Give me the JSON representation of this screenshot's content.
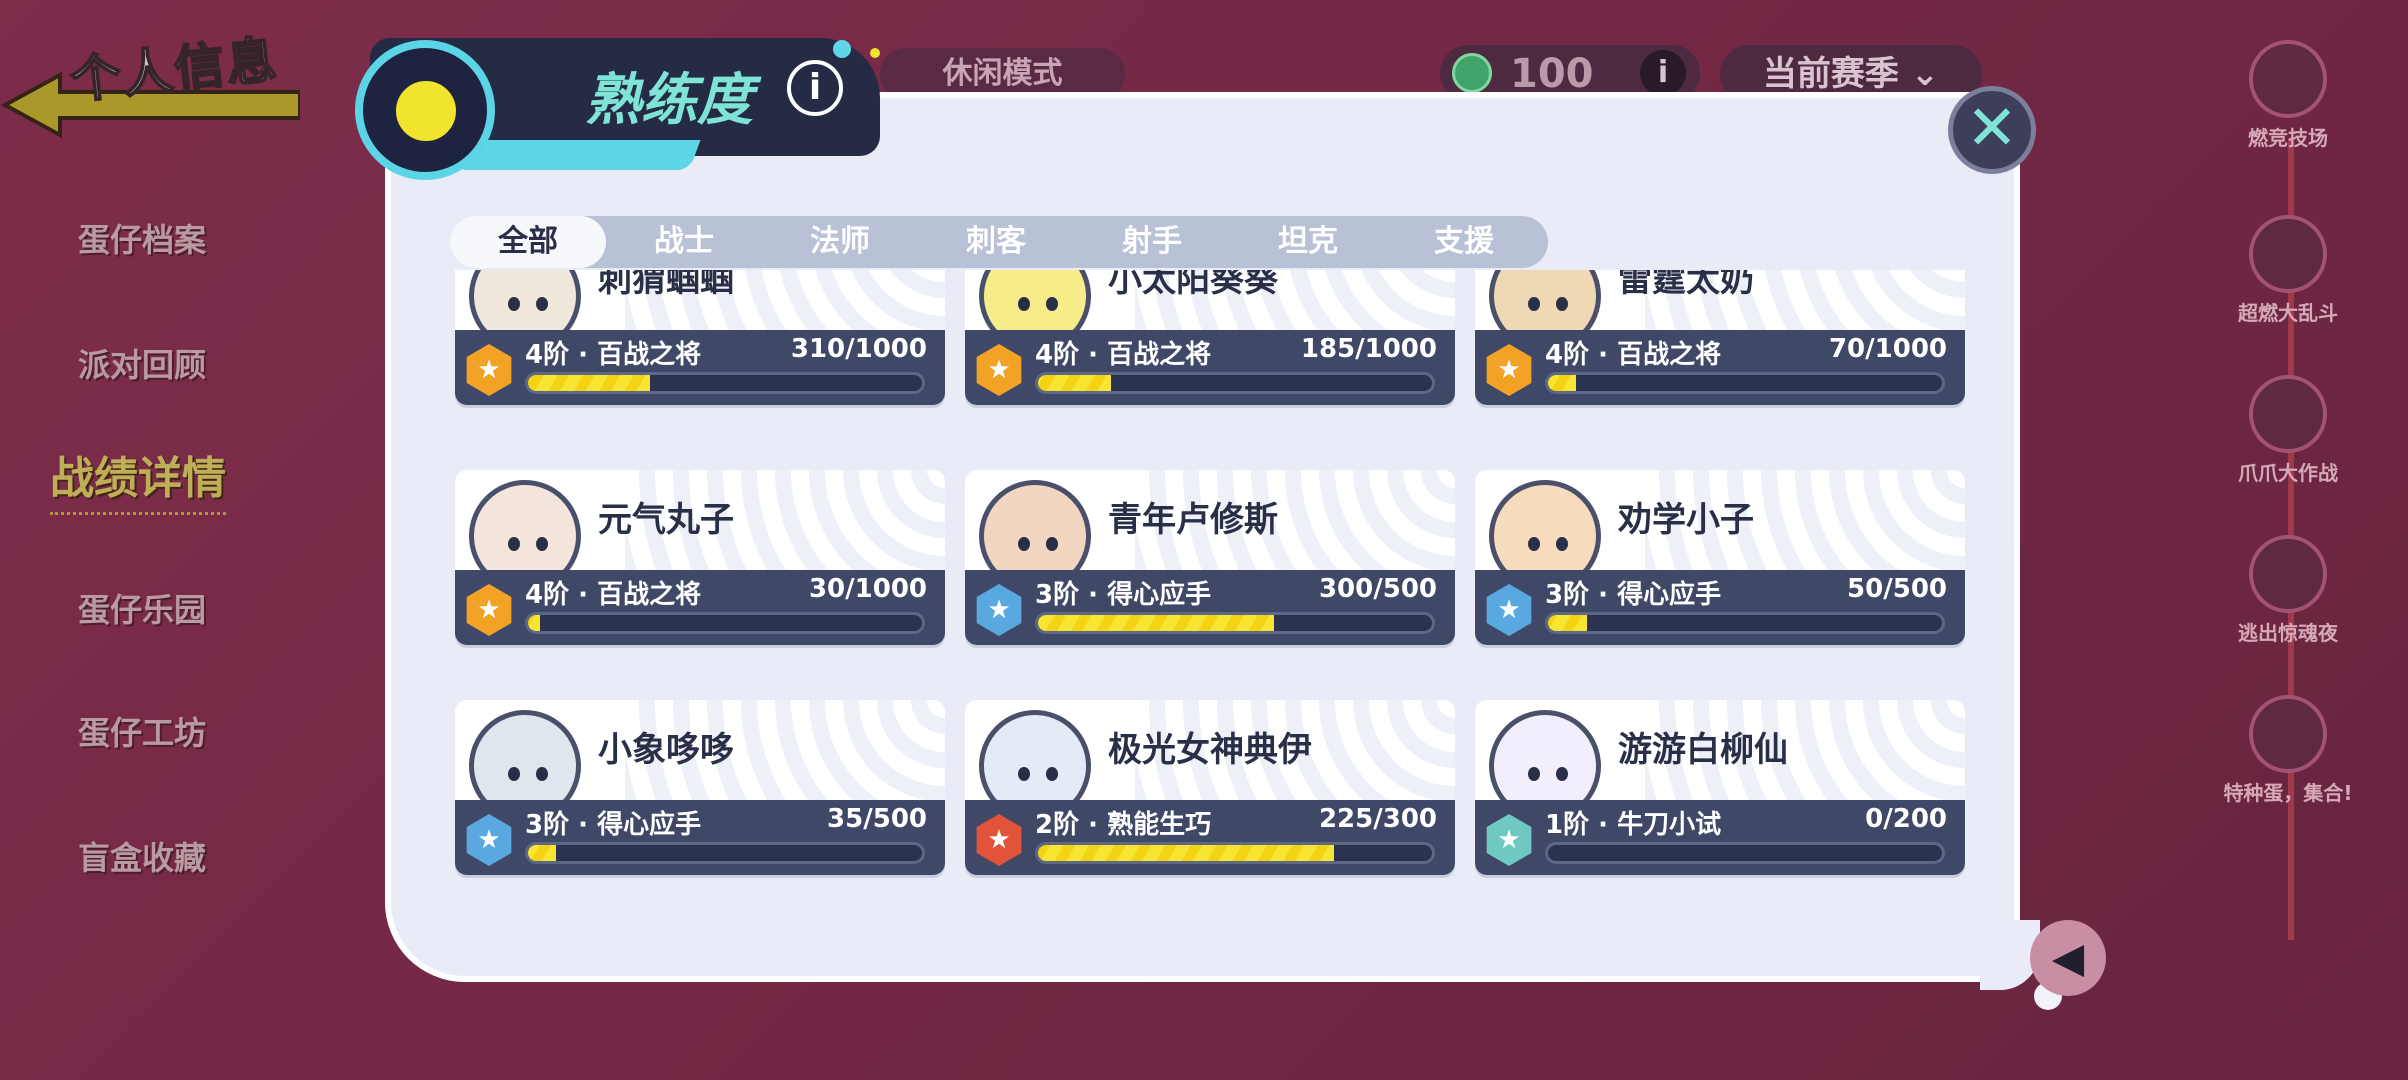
{
  "page_title": "个人信息",
  "left_nav": [
    {
      "label": "蛋仔档案",
      "active": false
    },
    {
      "label": "派对回顾",
      "active": false
    },
    {
      "label": "战绩详情",
      "active": true
    },
    {
      "label": "蛋仔乐园",
      "active": false
    },
    {
      "label": "蛋仔工坊",
      "active": false
    },
    {
      "label": "盲盒收藏",
      "active": false
    }
  ],
  "topbar": {
    "mode": "休闲模式",
    "coins": "100",
    "info": "i",
    "season": "当前赛季 ⌄"
  },
  "right_modes": [
    "燃竞技场",
    "超燃大乱斗",
    "爪爪大作战",
    "逃出惊魂夜",
    "特种蛋，集合!"
  ],
  "modal": {
    "title": "熟练度",
    "info": "i",
    "close": "✕",
    "tabs": [
      {
        "label": "全部",
        "active": true
      },
      {
        "label": "战士",
        "active": false
      },
      {
        "label": "法师",
        "active": false
      },
      {
        "label": "刺客",
        "active": false
      },
      {
        "label": "射手",
        "active": false
      },
      {
        "label": "坦克",
        "active": false
      },
      {
        "label": "支援",
        "active": false
      }
    ],
    "cards": [
      {
        "name": "刺猬蝈蝈",
        "rank": "4阶 · 百战之将",
        "value": "310/1000",
        "progress": 0.31,
        "tier": "gold",
        "face": "#efe6dc"
      },
      {
        "name": "小太阳葵葵",
        "rank": "4阶 · 百战之将",
        "value": "185/1000",
        "progress": 0.185,
        "tier": "gold",
        "face": "#f7ec8a"
      },
      {
        "name": "雷霆太奶",
        "rank": "4阶 · 百战之将",
        "value": "70/1000",
        "progress": 0.07,
        "tier": "gold",
        "face": "#efd9b4"
      },
      {
        "name": "元气丸子",
        "rank": "4阶 · 百战之将",
        "value": "30/1000",
        "progress": 0.03,
        "tier": "gold",
        "face": "#f3e5dc"
      },
      {
        "name": "青年卢修斯",
        "rank": "3阶 · 得心应手",
        "value": "300/500",
        "progress": 0.6,
        "tier": "blue",
        "face": "#f1d6c2"
      },
      {
        "name": "劝学小子",
        "rank": "3阶 · 得心应手",
        "value": "50/500",
        "progress": 0.1,
        "tier": "blue",
        "face": "#f6dcbd"
      },
      {
        "name": "小象哆哆",
        "rank": "3阶 · 得心应手",
        "value": "35/500",
        "progress": 0.07,
        "tier": "blue",
        "face": "#dfe6ee"
      },
      {
        "name": "极光女神典伊",
        "rank": "2阶 · 熟能生巧",
        "value": "225/300",
        "progress": 0.75,
        "tier": "red",
        "face": "#e3ecf6"
      },
      {
        "name": "游游白柳仙",
        "rank": "1阶 · 牛刀小试",
        "value": "0/200",
        "progress": 0.0,
        "tier": "teal",
        "face": "#f3eefb"
      }
    ]
  },
  "colors": {
    "tier_gold": "#f2a224",
    "tier_blue": "#5aa8e0",
    "tier_red": "#e2543a",
    "tier_teal": "#6fc9c2",
    "accent": "#5fd6e8",
    "progress": "#f7e531"
  },
  "icons": {
    "back": "arrow-left-icon",
    "close": "close-icon",
    "info": "info-icon",
    "rank": "star-badge-icon"
  }
}
